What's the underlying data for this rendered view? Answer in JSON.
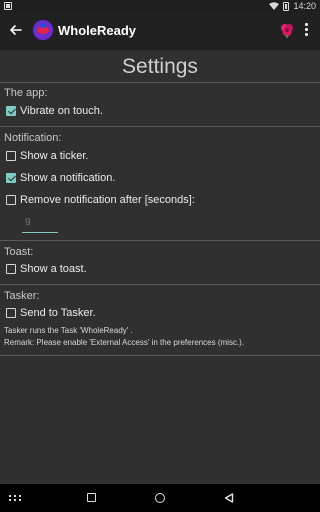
{
  "status_bar": {
    "time": "14:20"
  },
  "app_bar": {
    "title": "WholeReady"
  },
  "page": {
    "title": "Settings"
  },
  "sections": {
    "the_app": {
      "label": "The app:",
      "vibrate": {
        "label": "Vibrate on touch.",
        "checked": true
      }
    },
    "notification": {
      "label": "Notification:",
      "show_ticker": {
        "label": "Show a ticker.",
        "checked": false
      },
      "show_notification": {
        "label": "Show a notification.",
        "checked": true
      },
      "remove_after": {
        "label": "Remove notification after [seconds]:",
        "checked": false,
        "placeholder": "9"
      }
    },
    "toast": {
      "label": "Toast:",
      "show_toast": {
        "label": "Show a toast.",
        "checked": false
      }
    },
    "tasker": {
      "label": "Tasker:",
      "send": {
        "label": "Send to Tasker.",
        "checked": false
      },
      "note_line1": "Tasker runs the Task 'WholeReady' .",
      "note_line2": "Remark: Please enable 'External Access' in the preferences (misc.)."
    }
  },
  "colors": {
    "accent": "#80cbc4",
    "background": "#303030",
    "app_bar": "#212121"
  }
}
